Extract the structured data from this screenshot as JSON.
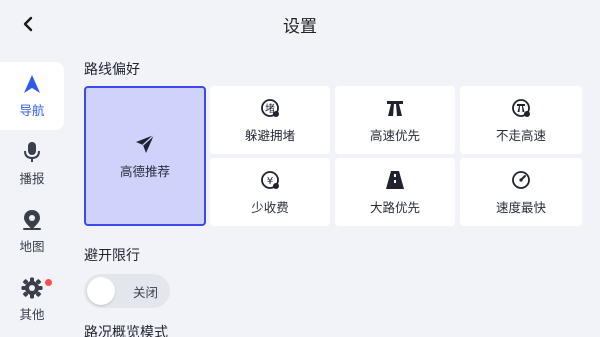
{
  "header": {
    "title": "设置",
    "back_icon": "chevron-left-icon"
  },
  "sidebar": {
    "items": [
      {
        "label": "导航",
        "icon": "navigation-arrow-icon",
        "active": true
      },
      {
        "label": "播报",
        "icon": "microphone-icon",
        "active": false
      },
      {
        "label": "地图",
        "icon": "map-pin-icon",
        "active": false
      },
      {
        "label": "其他",
        "icon": "gear-icon",
        "active": false,
        "badge": true
      }
    ]
  },
  "route_pref": {
    "title": "路线偏好",
    "options": [
      {
        "label": "高德推荐",
        "icon": "send-arrow-icon",
        "selected": true
      },
      {
        "label": "躲避拥堵",
        "icon": "avoid-congestion-icon"
      },
      {
        "label": "高速优先",
        "icon": "highway-icon"
      },
      {
        "label": "不走高速",
        "icon": "no-highway-icon"
      },
      {
        "label": "少收费",
        "icon": "yuan-coin-icon"
      },
      {
        "label": "大路优先",
        "icon": "main-road-icon"
      },
      {
        "label": "速度最快",
        "icon": "speedometer-icon"
      }
    ]
  },
  "restriction": {
    "title": "避开限行",
    "toggle_label": "关闭",
    "enabled": false
  },
  "next_section": {
    "title": "路况概览模式"
  },
  "colors": {
    "accent": "#2f5bea",
    "selected_bg": "#cfd2fb",
    "selected_border": "#3a4bea",
    "badge": "#ff4d4f"
  }
}
